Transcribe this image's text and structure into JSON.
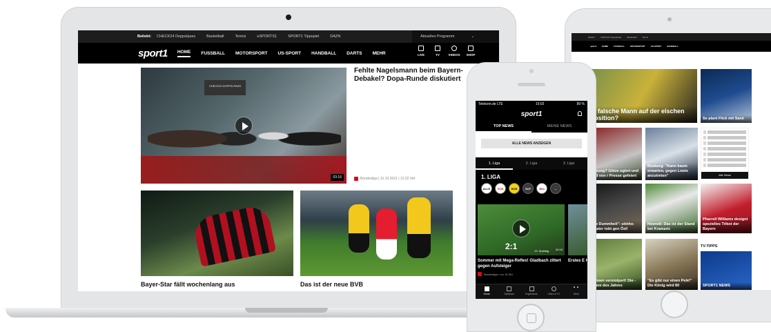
{
  "laptop": {
    "topbar": {
      "label": "Beliebt:",
      "links": [
        "CHECK24 Doppelpass",
        "Basketball",
        "Tennis",
        "eSPORTS1",
        "SPORT1 Tippspiel",
        "DAZN"
      ],
      "program": "Aktuelles Programm"
    },
    "nav": {
      "logo": "sport1",
      "items": [
        "HOME",
        "FUSSBALL",
        "MOTORSPORT",
        "US-SPORT",
        "HANDBALL",
        "DARTS",
        "MEHR"
      ],
      "icons": [
        {
          "icon": "calendar-icon",
          "label": "LIVE"
        },
        {
          "icon": "tv-icon",
          "label": "TV"
        },
        {
          "icon": "play-icon",
          "label": "VIDEOS"
        },
        {
          "icon": "cart-icon",
          "label": "SHOP"
        }
      ]
    },
    "feature": {
      "studio_sign": "CHECK24 DOPPELPASS",
      "duration": "03:16",
      "title": "Fehlte Nagelsmann beim Bayern-Debakel? Dopa-Runde diskutiert",
      "meta": "Bundesliga | 31.10.2021 | 12:32 Uhr"
    },
    "cards": [
      {
        "title": "Bayer-Star fällt wochenlang aus"
      },
      {
        "title": "Das ist der neue BVB"
      }
    ]
  },
  "phone": {
    "status": {
      "carrier": "Telekom.de LTE",
      "time": "15:02",
      "battery": "89 %"
    },
    "logo": "sport1",
    "tabs": [
      "TOP NEWS",
      "MEINE NEWS"
    ],
    "all_news_button": "ALLE NEWS ANZEIGEN",
    "league_tabs": [
      "1. Liga",
      "2. Liga",
      "3. Liga"
    ],
    "league_title": "1. LIGA",
    "clubs": [
      "ALLE",
      "FCB",
      "BVB",
      "SCF",
      "B04",
      "VfL"
    ],
    "video": {
      "score": "2:1",
      "matchday": "13. Spieltag",
      "duration": "00:18"
    },
    "headline": "Sommer mit Mega-Reflex! Gladbach zittert gegen Aufsteiger",
    "headline_2": "Erstes E Haaland",
    "meta": "Bundesliga • vor 15 Std.",
    "bottom_nav": [
      "Home",
      "Spielplan",
      "Ergebnisse",
      "Video & TV",
      "Mehr"
    ]
  },
  "tablet": {
    "tiles": [
      {
        "caption": "er falsche Mann auf der elschen Position?"
      },
      {
        "caption": "Se plant Flick mit Sané"
      },
      {
        "caption": "rletzung? Götze ugiert und wird von r Presse gefeiert"
      },
      {
        "caption": "Rosberg: \"Kann kaum erwarten, gegen Lewis anzutreten\""
      },
      {
        "caption": "eine Dummheit\": utinho-Berater tobt gen Özil"
      },
      {
        "caption": "Hoeneß: Das ist der Stand bei Kramaric"
      },
      {
        "caption": "Pharrell Williams designt spezielles Trikot der Bayern"
      },
      {
        "caption": "chdown verstolpert! Die -Panne des Jahres"
      },
      {
        "caption": "\"Es gibt nur einen Pelé!\" Die König wird 80"
      }
    ],
    "all_news": "Alle News",
    "tv_tips": "TV-TIPPS",
    "tv_tile": "SPORT1 NEWS"
  },
  "colors": {
    "brand_black": "#000000",
    "accent_red": "#e30613"
  }
}
